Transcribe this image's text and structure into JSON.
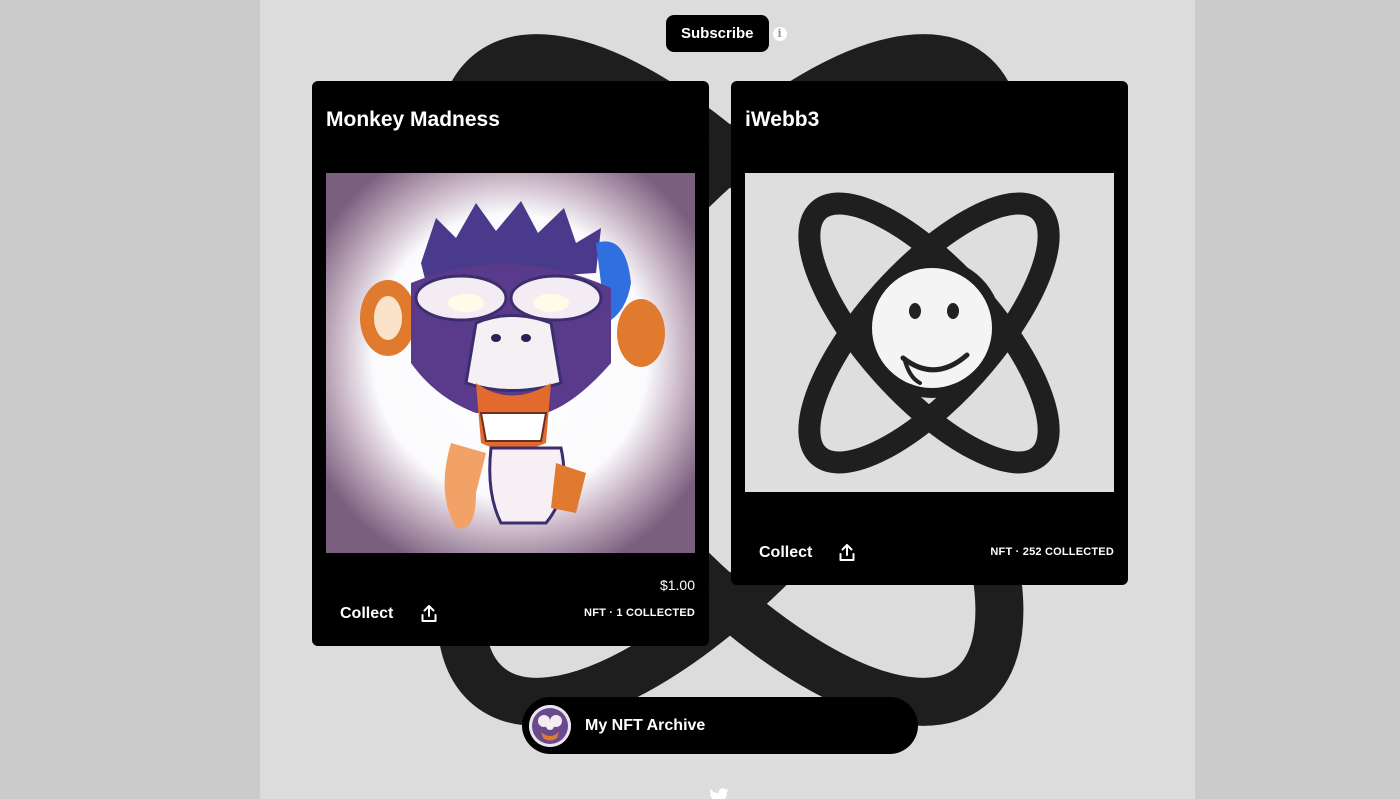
{
  "header": {
    "subscribe_label": "Subscribe",
    "info_icon": "info-icon"
  },
  "cards": [
    {
      "title": "Monkey Madness",
      "image_icon": "monkey-artwork",
      "price": "$1.00",
      "collect_label": "Collect",
      "share_icon": "share-icon",
      "stats": "NFT · 1 COLLECTED"
    },
    {
      "title": "iWebb3",
      "image_icon": "smiley-rings-artwork",
      "collect_label": "Collect",
      "share_icon": "share-icon",
      "stats": "NFT · 252 COLLECTED"
    }
  ],
  "footer": {
    "archive_name": "My NFT Archive",
    "avatar_icon": "avatar",
    "social_icon": "twitter-icon"
  },
  "colors": {
    "page_bg": "#dcdcdc",
    "outer_bg": "#cbcbcb",
    "card_bg": "#000000",
    "text": "#ffffff"
  }
}
